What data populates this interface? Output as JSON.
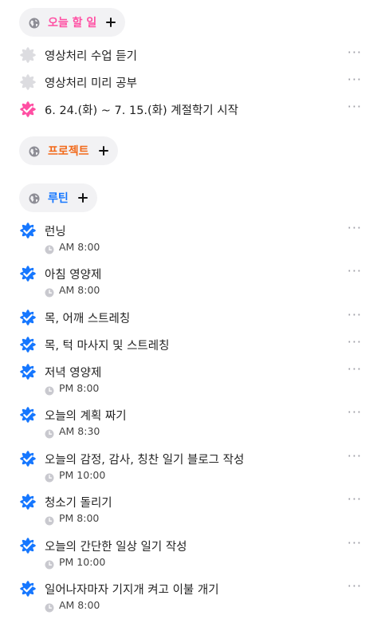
{
  "colors": {
    "today": "#ff4fa3",
    "project": "#f26a1b",
    "routine": "#1677ff",
    "unchecked": "#dcdce0",
    "globe": "#8e8e96"
  },
  "today": {
    "title": "오늘 할 일",
    "items": [
      {
        "label": "영상처리 수업 듣기",
        "checked": false
      },
      {
        "label": "영상처리 미리 공부",
        "checked": false
      },
      {
        "label": "6. 24.(화) ~ 7. 15.(화) 계절학기 시작",
        "checked": true
      }
    ]
  },
  "project": {
    "title": "프로젝트"
  },
  "routine": {
    "title": "루틴",
    "items": [
      {
        "label": "런닝",
        "time": "AM 8:00"
      },
      {
        "label": "아침 영양제",
        "time": "AM 8:00"
      },
      {
        "label": "목, 어깨 스트레칭",
        "time": ""
      },
      {
        "label": "목, 턱 마사지 및 스트레칭",
        "time": ""
      },
      {
        "label": "저녁 영양제",
        "time": "PM 8:00"
      },
      {
        "label": "오늘의 계획 짜기",
        "time": "AM 8:30"
      },
      {
        "label": "오늘의 감정, 감사, 칭찬 일기 블로그 작성",
        "time": "PM 10:00"
      },
      {
        "label": "청소기 돌리기",
        "time": "PM 8:00"
      },
      {
        "label": "오늘의 간단한 일상 일기 작성",
        "time": "PM 10:00"
      },
      {
        "label": "일어나자마자 기지개 켜고 이불 개기",
        "time": "AM 8:00"
      }
    ]
  },
  "more_label": "···"
}
